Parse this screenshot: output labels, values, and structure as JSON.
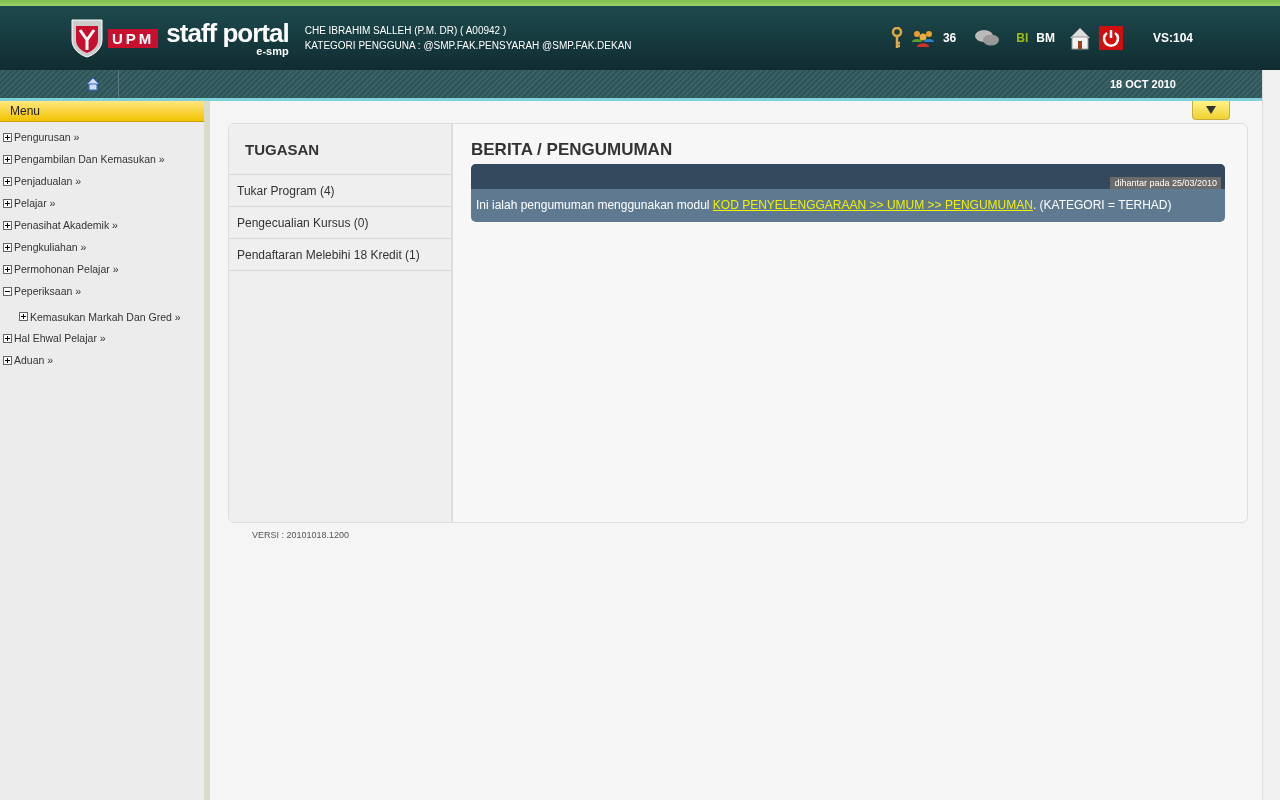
{
  "header": {
    "logo": {
      "brand": "UPM",
      "title": "staff portal",
      "subtitle": "e-smp"
    },
    "user": {
      "name": "CHE IBRAHIM SALLEH (P.M. DR) ( A00942 )",
      "category": "KATEGORI PENGGUNA : @SMP.FAK.PENSYARAH @SMP.FAK.DEKAN"
    },
    "online_count": "36",
    "languages": [
      {
        "label": "BI",
        "selected": true
      },
      {
        "label": "BM",
        "selected": false
      }
    ],
    "version": "VS:104"
  },
  "breadcrumb": {
    "date": "18 OCT 2010"
  },
  "panel_toggle": {
    "expanded": false
  },
  "sidebar": {
    "title": "Menu",
    "items": [
      {
        "label": "Pengurusan »",
        "expanded": false
      },
      {
        "label": "Pengambilan Dan Kemasukan »",
        "expanded": false
      },
      {
        "label": "Penjadualan »",
        "expanded": false
      },
      {
        "label": "Pelajar »",
        "expanded": false
      },
      {
        "label": "Penasihat Akademik »",
        "expanded": false
      },
      {
        "label": "Pengkuliahan »",
        "expanded": false
      },
      {
        "label": "Permohonan Pelajar »",
        "expanded": false
      },
      {
        "label": "Peperiksaan »",
        "expanded": true,
        "children": [
          {
            "label": "Kemasukan Markah Dan Gred »",
            "expanded": false
          }
        ]
      },
      {
        "label": "Hal Ehwal Pelajar »",
        "expanded": false
      },
      {
        "label": "Aduan »",
        "expanded": false
      }
    ]
  },
  "tasks": {
    "title": "TUGASAN",
    "items": [
      "Tukar Program (4)",
      "Pengecualian Kursus (0)",
      "Pendaftaran Melebihi 18 Kredit (1)"
    ]
  },
  "news": {
    "title": "BERITA / PENGUMUMAN",
    "posts": [
      {
        "posted": "dihantar pada 25/03/2010",
        "text_before": "Ini ialah pengumuman menggunakan modul ",
        "link": "KOD PENYELENGGARAAN >> UMUM >> PENGUMUMAN",
        "text_after": ". (KATEGORI = TERHAD)"
      }
    ]
  },
  "footer": {
    "version": "VERSI : 20101018.1200"
  }
}
